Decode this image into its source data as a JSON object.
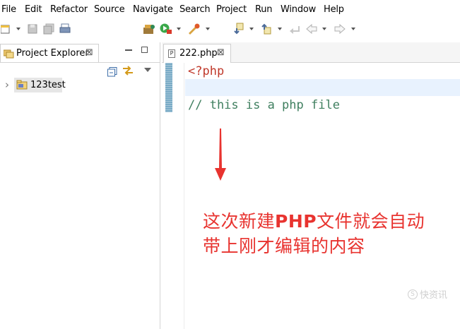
{
  "menubar": {
    "items": [
      "File",
      "Edit",
      "Refactor",
      "Source",
      "Navigate",
      "Search",
      "Project",
      "Run",
      "Window",
      "Help"
    ]
  },
  "left_panel": {
    "tab_title": "Project Explorer",
    "close_glyph": "⊠",
    "tree": [
      {
        "label": "123test",
        "expander": "›"
      }
    ]
  },
  "editor": {
    "tab_title": "222.php",
    "close_glyph": "⊠",
    "file_icon_letter": "P",
    "code_lines": [
      {
        "text": "<?php",
        "color": "#c0392b"
      },
      {
        "text": "",
        "color": "#000000"
      },
      {
        "text": "// this is a php file",
        "color": "#3f7f5f"
      }
    ]
  },
  "annotation": {
    "line1_a": "这次新建",
    "line1_b": "PHP",
    "line1_c": "文件就会自动",
    "line2": "带上刚才编辑的内容",
    "color": "#e8332f"
  },
  "watermark": {
    "text": "快资讯",
    "icon": "s-logo-icon"
  },
  "colors": {
    "accent": "#4d8fb3",
    "current_line": "#e8f2fe",
    "arrow": "#e8332f"
  }
}
